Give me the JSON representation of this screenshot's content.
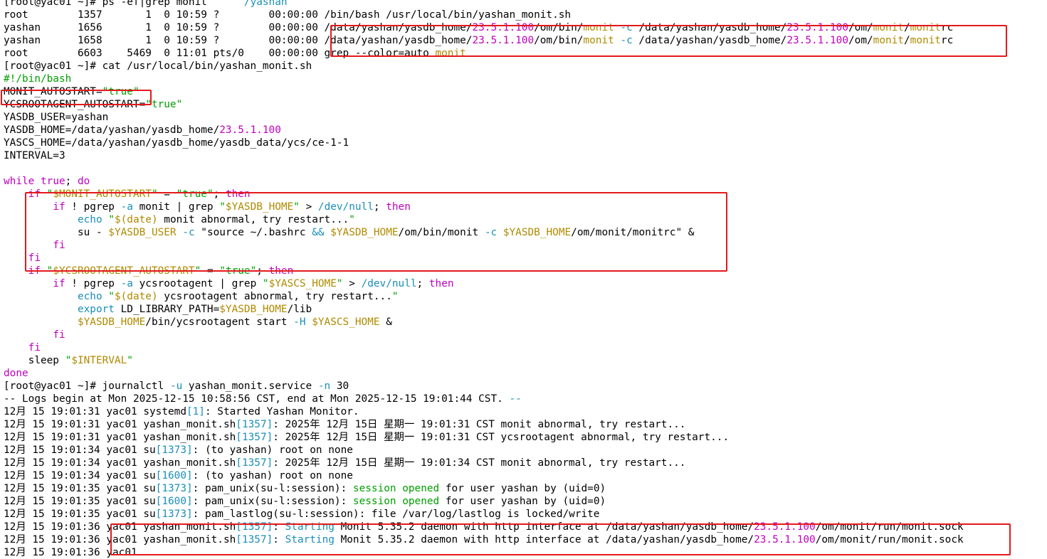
{
  "colors": {
    "text": "#000000",
    "keyword": "#c000c0",
    "string": "#00a000",
    "variable": "#b08a00",
    "number": "#c000c0",
    "path": "#1a8fb8",
    "highlight_border": "#e3191c",
    "background": "#ffffff"
  },
  "terminal": {
    "lines": [
      [
        {
          "t": "[root@yac01 ~]# ps -ef|grep monit      ",
          "c": ""
        },
        {
          "t": "/yashan",
          "c": "path"
        }
      ],
      [
        {
          "t": "root        1357       1  0 10:59 ?        00:00:00 /bin/bash /usr/local/bin/yashan_monit.sh",
          "c": ""
        }
      ],
      [
        {
          "t": "yashan      1656       1  0 10:59 ?        00:00:00 /data/yashan/yasdb_home/",
          "c": ""
        },
        {
          "t": "23.5.1.100",
          "c": "number"
        },
        {
          "t": "/om/bin/",
          "c": ""
        },
        {
          "t": "monit",
          "c": "var"
        },
        {
          "t": " ",
          "c": ""
        },
        {
          "t": "-c",
          "c": "path"
        },
        {
          "t": " /data/yashan/yasdb_home/",
          "c": ""
        },
        {
          "t": "23.5.1.100",
          "c": "number"
        },
        {
          "t": "/om/",
          "c": ""
        },
        {
          "t": "monit",
          "c": "var"
        },
        {
          "t": "/",
          "c": ""
        },
        {
          "t": "monit",
          "c": "var"
        },
        {
          "t": "rc",
          "c": ""
        }
      ],
      [
        {
          "t": "yashan      1658       1  0 10:59 ?        00:00:00 /data/yashan/yasdb_home/",
          "c": ""
        },
        {
          "t": "23.5.1.100",
          "c": "number"
        },
        {
          "t": "/om/bin/",
          "c": ""
        },
        {
          "t": "monit",
          "c": "var"
        },
        {
          "t": " ",
          "c": ""
        },
        {
          "t": "-c",
          "c": "path"
        },
        {
          "t": " /data/yashan/yasdb_home/",
          "c": ""
        },
        {
          "t": "23.5.1.100",
          "c": "number"
        },
        {
          "t": "/om/",
          "c": ""
        },
        {
          "t": "monit",
          "c": "var"
        },
        {
          "t": "/",
          "c": ""
        },
        {
          "t": "monit",
          "c": "var"
        },
        {
          "t": "rc",
          "c": ""
        }
      ],
      [
        {
          "t": "root        6603    5469  0 11:01 pts/0    00:00:00 grep --color=auto ",
          "c": ""
        },
        {
          "t": "monit",
          "c": "var"
        }
      ],
      [
        {
          "t": "[root@yac01 ~]# cat /usr/local/bin/yashan_monit.sh",
          "c": ""
        }
      ],
      [
        {
          "t": "#!/bin/bash",
          "c": "str"
        }
      ],
      [
        {
          "t": "MONIT_AUTOSTART=",
          "c": ""
        },
        {
          "t": "\"true\"",
          "c": "str"
        }
      ],
      [
        {
          "t": "YCSROOTAGENT_AUTOSTART=",
          "c": ""
        },
        {
          "t": "\"true\"",
          "c": "str"
        }
      ],
      [
        {
          "t": "YASDB_USER=yashan",
          "c": ""
        }
      ],
      [
        {
          "t": "YASDB_HOME=/data/yashan/yasdb_home/",
          "c": ""
        },
        {
          "t": "23.5.1.100",
          "c": "number"
        }
      ],
      [
        {
          "t": "YASCS_HOME=/data/yashan/yasdb_home/yasdb_data/ycs/ce-1-1",
          "c": ""
        }
      ],
      [
        {
          "t": "INTERVAL=3",
          "c": ""
        }
      ],
      [
        {
          "t": "",
          "c": ""
        }
      ],
      [
        {
          "t": "while",
          "c": "kw"
        },
        {
          "t": " ",
          "c": ""
        },
        {
          "t": "true",
          "c": "kw"
        },
        {
          "t": "; ",
          "c": ""
        },
        {
          "t": "do",
          "c": "kw"
        }
      ],
      [
        {
          "t": "    ",
          "c": ""
        },
        {
          "t": "if",
          "c": "kw"
        },
        {
          "t": " ",
          "c": ""
        },
        {
          "t": "\"",
          "c": "str"
        },
        {
          "t": "$MONIT_AUTOSTART",
          "c": "var"
        },
        {
          "t": "\"",
          "c": "str"
        },
        {
          "t": " = ",
          "c": ""
        },
        {
          "t": "\"true\"",
          "c": "str"
        },
        {
          "t": "; ",
          "c": ""
        },
        {
          "t": "then",
          "c": "kw"
        }
      ],
      [
        {
          "t": "        ",
          "c": ""
        },
        {
          "t": "if",
          "c": "kw"
        },
        {
          "t": " ! pgrep ",
          "c": ""
        },
        {
          "t": "-a",
          "c": "path"
        },
        {
          "t": " monit | grep ",
          "c": ""
        },
        {
          "t": "\"",
          "c": "str"
        },
        {
          "t": "$YASDB_HOME",
          "c": "var"
        },
        {
          "t": "\"",
          "c": "str"
        },
        {
          "t": " > ",
          "c": ""
        },
        {
          "t": "/dev/null",
          "c": "path"
        },
        {
          "t": "; ",
          "c": ""
        },
        {
          "t": "then",
          "c": "kw"
        }
      ],
      [
        {
          "t": "            ",
          "c": ""
        },
        {
          "t": "echo",
          "c": "path"
        },
        {
          "t": " ",
          "c": ""
        },
        {
          "t": "\"",
          "c": "str"
        },
        {
          "t": "$(date)",
          "c": "var"
        },
        {
          "t": " monit abnormal, try restart...",
          "c": ""
        },
        {
          "t": "\"",
          "c": "str"
        }
      ],
      [
        {
          "t": "            su - ",
          "c": ""
        },
        {
          "t": "$YASDB_USER",
          "c": "var"
        },
        {
          "t": " ",
          "c": ""
        },
        {
          "t": "-c",
          "c": "path"
        },
        {
          "t": " ",
          "c": ""
        },
        {
          "t": "\"source ~/.bashrc ",
          "c": ""
        },
        {
          "t": "&&",
          "c": "path"
        },
        {
          "t": " ",
          "c": ""
        },
        {
          "t": "$YASDB_HOME",
          "c": "var"
        },
        {
          "t": "/om/bin/monit ",
          "c": ""
        },
        {
          "t": "-c",
          "c": "path"
        },
        {
          "t": " ",
          "c": ""
        },
        {
          "t": "$YASDB_HOME",
          "c": "var"
        },
        {
          "t": "/om/monit/monitrc\" &",
          "c": ""
        }
      ],
      [
        {
          "t": "        ",
          "c": ""
        },
        {
          "t": "fi",
          "c": "kw"
        }
      ],
      [
        {
          "t": "    ",
          "c": ""
        },
        {
          "t": "fi",
          "c": "kw"
        }
      ],
      [
        {
          "t": "    ",
          "c": ""
        },
        {
          "t": "if",
          "c": "kw"
        },
        {
          "t": " ",
          "c": ""
        },
        {
          "t": "\"",
          "c": "str"
        },
        {
          "t": "$YCSROOTAGENT_AUTOSTART",
          "c": "var"
        },
        {
          "t": "\"",
          "c": "str"
        },
        {
          "t": " = ",
          "c": ""
        },
        {
          "t": "\"true\"",
          "c": "str"
        },
        {
          "t": "; ",
          "c": ""
        },
        {
          "t": "then",
          "c": "kw"
        }
      ],
      [
        {
          "t": "        ",
          "c": ""
        },
        {
          "t": "if",
          "c": "kw"
        },
        {
          "t": " ! pgrep ",
          "c": ""
        },
        {
          "t": "-a",
          "c": "path"
        },
        {
          "t": " ycsrootagent | grep ",
          "c": ""
        },
        {
          "t": "\"",
          "c": "str"
        },
        {
          "t": "$YASCS_HOME",
          "c": "var"
        },
        {
          "t": "\"",
          "c": "str"
        },
        {
          "t": " > ",
          "c": ""
        },
        {
          "t": "/dev/null",
          "c": "path"
        },
        {
          "t": "; ",
          "c": ""
        },
        {
          "t": "then",
          "c": "kw"
        }
      ],
      [
        {
          "t": "            ",
          "c": ""
        },
        {
          "t": "echo",
          "c": "path"
        },
        {
          "t": " ",
          "c": ""
        },
        {
          "t": "\"",
          "c": "str"
        },
        {
          "t": "$(date)",
          "c": "var"
        },
        {
          "t": " ycsrootagent abnormal, try restart...",
          "c": ""
        },
        {
          "t": "\"",
          "c": "str"
        }
      ],
      [
        {
          "t": "            ",
          "c": ""
        },
        {
          "t": "export",
          "c": "path"
        },
        {
          "t": " LD_LIBRARY_PATH=",
          "c": ""
        },
        {
          "t": "$YASDB_HOME",
          "c": "var"
        },
        {
          "t": "/lib",
          "c": ""
        }
      ],
      [
        {
          "t": "            ",
          "c": ""
        },
        {
          "t": "$YASDB_HOME",
          "c": "var"
        },
        {
          "t": "/bin/ycsrootagent start ",
          "c": ""
        },
        {
          "t": "-H",
          "c": "path"
        },
        {
          "t": " ",
          "c": ""
        },
        {
          "t": "$YASCS_HOME",
          "c": "var"
        },
        {
          "t": " &",
          "c": ""
        }
      ],
      [
        {
          "t": "        ",
          "c": ""
        },
        {
          "t": "fi",
          "c": "kw"
        }
      ],
      [
        {
          "t": "    ",
          "c": ""
        },
        {
          "t": "fi",
          "c": "kw"
        }
      ],
      [
        {
          "t": "    sleep ",
          "c": ""
        },
        {
          "t": "\"",
          "c": "str"
        },
        {
          "t": "$INTERVAL",
          "c": "var"
        },
        {
          "t": "\"",
          "c": "str"
        }
      ],
      [
        {
          "t": "done",
          "c": "kw"
        }
      ],
      [
        {
          "t": "[root@yac01 ~]# journalctl ",
          "c": ""
        },
        {
          "t": "-u",
          "c": "path"
        },
        {
          "t": " yashan_monit.service ",
          "c": ""
        },
        {
          "t": "-n",
          "c": "path"
        },
        {
          "t": " 30",
          "c": ""
        }
      ],
      [
        {
          "t": "-- Logs begin at Mon 2025-12-15 10:58:56 CST, end at Mon 2025-12-15 19:01:44 CST. ",
          "c": ""
        },
        {
          "t": "--",
          "c": "path"
        }
      ],
      [
        {
          "t": "12月 15 19:01:31 yac01 systemd",
          "c": ""
        },
        {
          "t": "[1]",
          "c": "path"
        },
        {
          "t": ": Started Yashan Monitor.",
          "c": ""
        }
      ],
      [
        {
          "t": "12月 15 19:01:31 yac01 yashan_monit.sh",
          "c": ""
        },
        {
          "t": "[1357]",
          "c": "path"
        },
        {
          "t": ": 2025年 12月 15日 星期一 19:01:31 CST monit abnormal, try restart...",
          "c": ""
        }
      ],
      [
        {
          "t": "12月 15 19:01:31 yac01 yashan_monit.sh",
          "c": ""
        },
        {
          "t": "[1357]",
          "c": "path"
        },
        {
          "t": ": 2025年 12月 15日 星期一 19:01:31 CST ycsrootagent abnormal, try restart...",
          "c": ""
        }
      ],
      [
        {
          "t": "12月 15 19:01:34 yac01 su",
          "c": ""
        },
        {
          "t": "[1373]",
          "c": "path"
        },
        {
          "t": ": (to yashan) root on none",
          "c": ""
        }
      ],
      [
        {
          "t": "12月 15 19:01:34 yac01 yashan_monit.sh",
          "c": ""
        },
        {
          "t": "[1357]",
          "c": "path"
        },
        {
          "t": ": 2025年 12月 15日 星期一 19:01:34 CST monit abnormal, try restart...",
          "c": ""
        }
      ],
      [
        {
          "t": "12月 15 19:01:34 yac01 su",
          "c": ""
        },
        {
          "t": "[1600]",
          "c": "path"
        },
        {
          "t": ": (to yashan) root on none",
          "c": ""
        }
      ],
      [
        {
          "t": "12月 15 19:01:35 yac01 su",
          "c": ""
        },
        {
          "t": "[1373]",
          "c": "path"
        },
        {
          "t": ": pam_unix(su-l:session): ",
          "c": ""
        },
        {
          "t": "session opened",
          "c": "str"
        },
        {
          "t": " for user yashan by (uid=0)",
          "c": ""
        }
      ],
      [
        {
          "t": "12月 15 19:01:35 yac01 su",
          "c": ""
        },
        {
          "t": "[1600]",
          "c": "path"
        },
        {
          "t": ": pam_unix(su-l:session): ",
          "c": ""
        },
        {
          "t": "session opened",
          "c": "str"
        },
        {
          "t": " for user yashan by (uid=0)",
          "c": ""
        }
      ],
      [
        {
          "t": "12月 15 19:01:35 yac01 su",
          "c": ""
        },
        {
          "t": "[1373]",
          "c": "path"
        },
        {
          "t": ": pam_lastlog(su-l:session): file /var/log/lastlog is locked/write",
          "c": ""
        }
      ],
      [
        {
          "t": "12月 15 19:01:36 yac01 yashan_monit.sh",
          "c": ""
        },
        {
          "t": "[1357]",
          "c": "path"
        },
        {
          "t": ": ",
          "c": ""
        },
        {
          "t": "Starting",
          "c": "path"
        },
        {
          "t": " Monit 5.35.2 daemon with http interface at /data/yashan/yasdb_home/",
          "c": ""
        },
        {
          "t": "23.5.1.100",
          "c": "number"
        },
        {
          "t": "/om/monit/run/monit.sock",
          "c": ""
        }
      ],
      [
        {
          "t": "12月 15 19:01:36 yac01 yashan_monit.sh",
          "c": ""
        },
        {
          "t": "[1357]",
          "c": "path"
        },
        {
          "t": ": ",
          "c": ""
        },
        {
          "t": "Starting",
          "c": "path"
        },
        {
          "t": " Monit 5.35.2 daemon with http interface at /data/yashan/yasdb_home/",
          "c": ""
        },
        {
          "t": "23.5.1.100",
          "c": "number"
        },
        {
          "t": "/om/monit/run/monit.sock",
          "c": ""
        }
      ],
      [
        {
          "t": "12月 15 19:01:36 yac01 ",
          "c": ""
        }
      ]
    ]
  }
}
